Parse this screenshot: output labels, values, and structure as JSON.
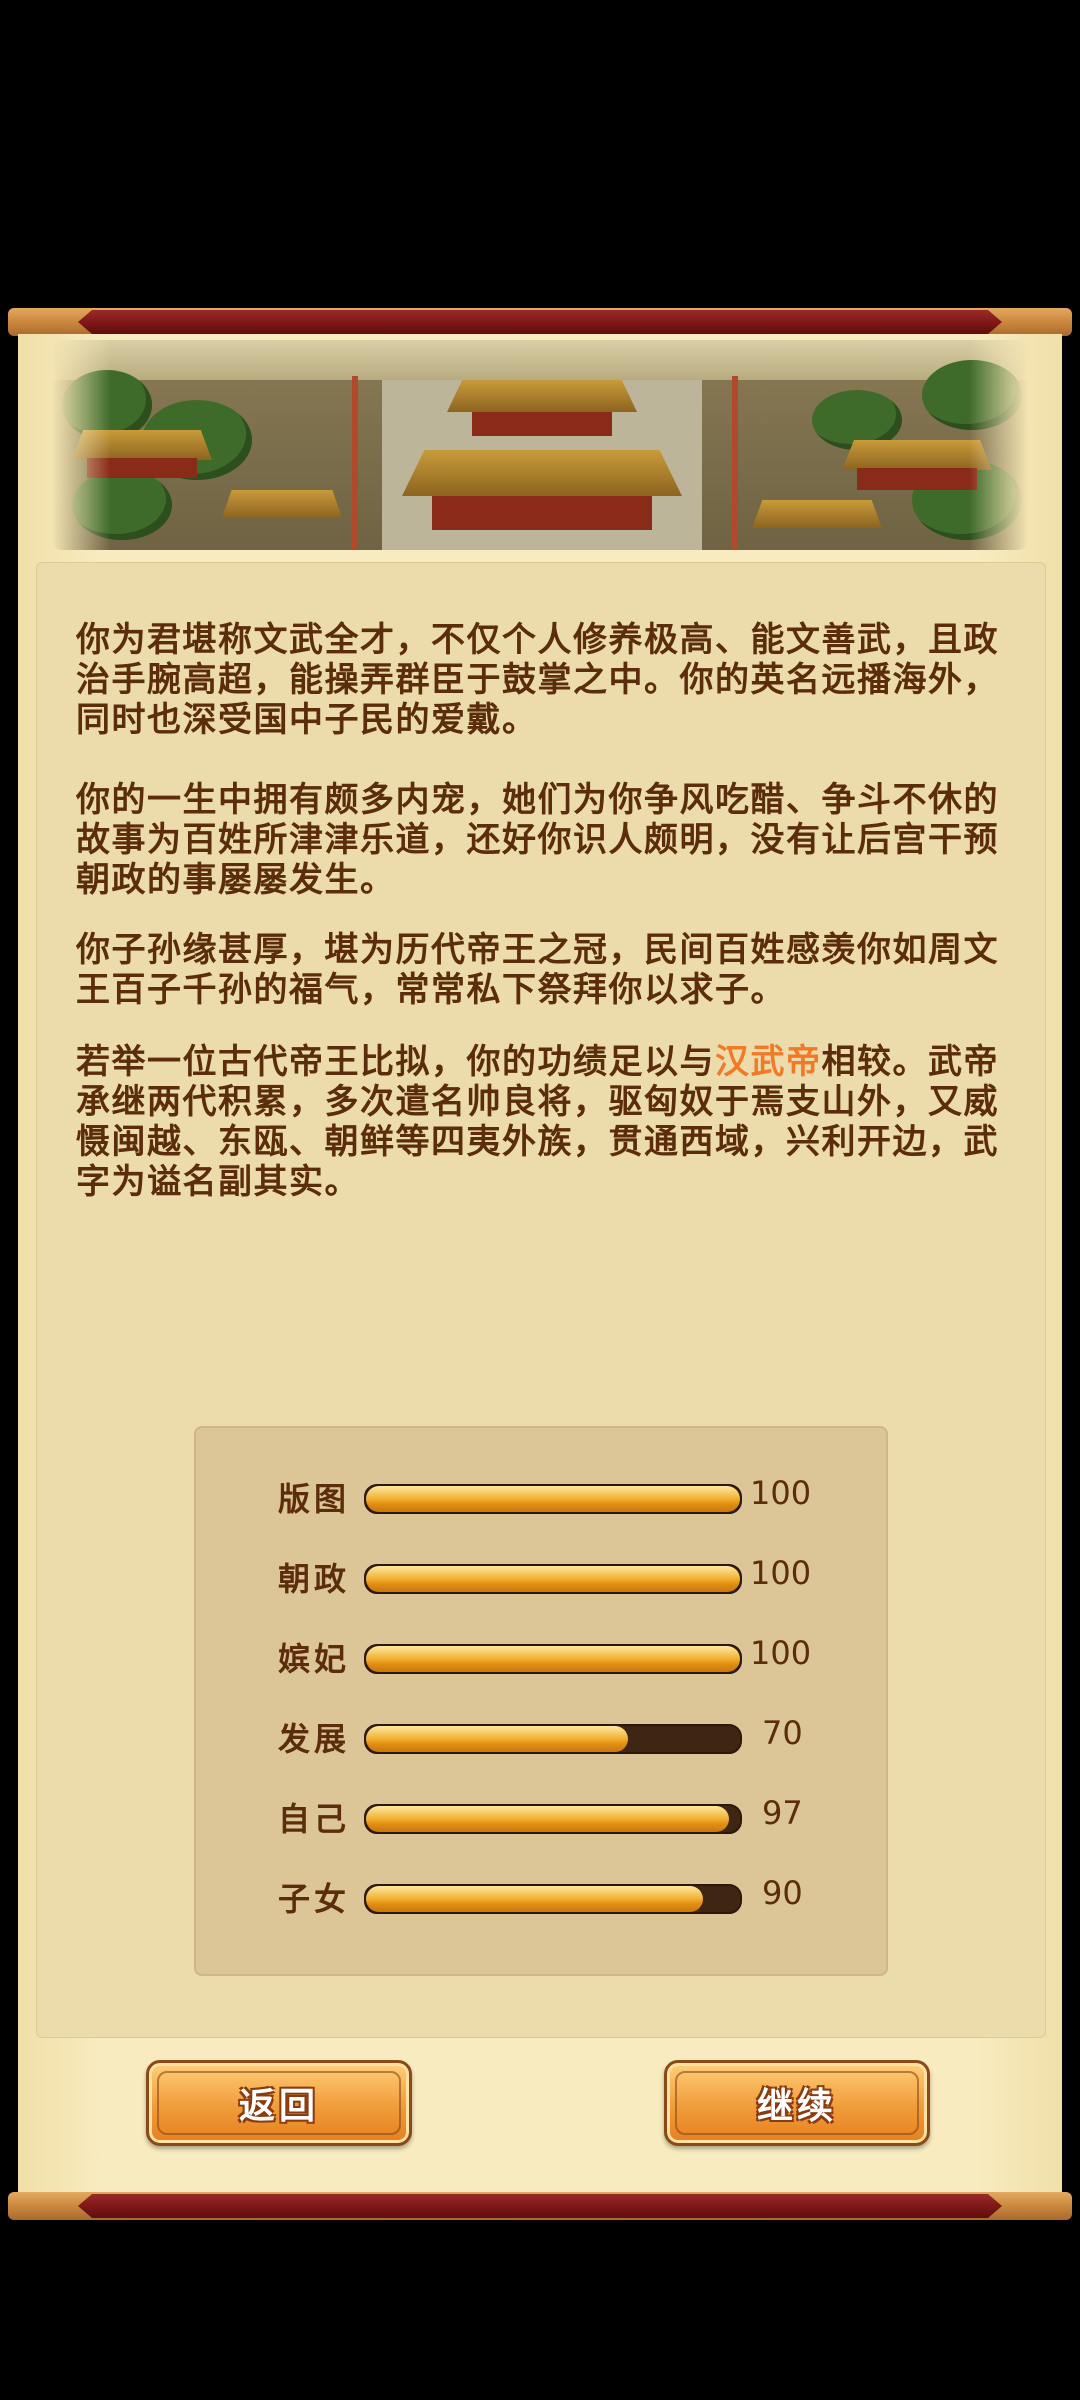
{
  "summary": {
    "paragraphs": [
      "你为君堪称文武全才，不仅个人修养极高、能文善武，且政治手腕高超，能操弄群臣于鼓掌之中。你的英名远播海外，同时也深受国中子民的爱戴。",
      "你的一生中拥有颇多内宠，她们为你争风吃醋、争斗不休的故事为百姓所津津乐道，还好你识人颇明，没有让后宫干预朝政的事屡屡发生。",
      "你子孙缘甚厚，堪为历代帝王之冠，民间百姓感羡你如周文王百子千孙的福气，常常私下祭拜你以求子。"
    ],
    "comparison": {
      "before": "若举一位古代帝王比拟，你的功绩足以与",
      "emperor": "汉武帝",
      "after": "相较。武帝承继两代积累，多次遣名帅良将，驱匈奴于焉支山外，又威慑闽越、东瓯、朝鲜等四夷外族，贯通西域，兴利开边，武字为谥名副其实。"
    },
    "highlight_color": "#f07a28"
  },
  "stats": [
    {
      "label": "版图",
      "value": "100",
      "fill": 1.0
    },
    {
      "label": "朝政",
      "value": "100",
      "fill": 1.0
    },
    {
      "label": "嫔妃",
      "value": "100",
      "fill": 1.0
    },
    {
      "label": "发展",
      "value": "70",
      "fill": 0.7
    },
    {
      "label": "自己",
      "value": "97",
      "fill": 0.97
    },
    {
      "label": "子女",
      "value": "90",
      "fill": 0.9
    }
  ],
  "buttons": {
    "back": "返回",
    "continue": "继续"
  }
}
